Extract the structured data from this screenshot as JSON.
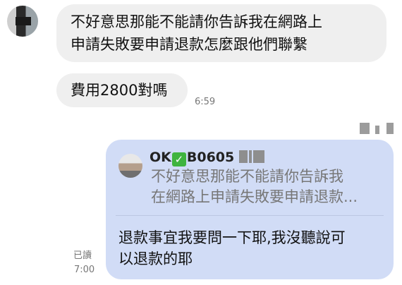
{
  "messages": {
    "incoming_1": {
      "line1": "不好意思那能不能請你告訴我在網路上",
      "line2": "申請失敗要申請退款怎麼跟他們聯繫"
    },
    "incoming_2": {
      "text": "費用2800對嗎",
      "time": "6:59"
    },
    "outgoing_reply": {
      "quote_sender_prefix": "OK",
      "quote_sender_check": "✓",
      "quote_sender_suffix": "B0605",
      "quote_line1": "不好意思那能不能請你告訴我",
      "quote_line2": "在網路上申請失敗要申請退款...",
      "reply_line1": "退款事宜我要問一下耶,我沒聽說可",
      "reply_line2": "以退款的耶",
      "read_status": "已讀",
      "time": "7:00"
    }
  },
  "colors": {
    "incoming_bubble": "#efefef",
    "outgoing_bubble": "#d1dcf6",
    "check_badge": "#3fb43f"
  }
}
